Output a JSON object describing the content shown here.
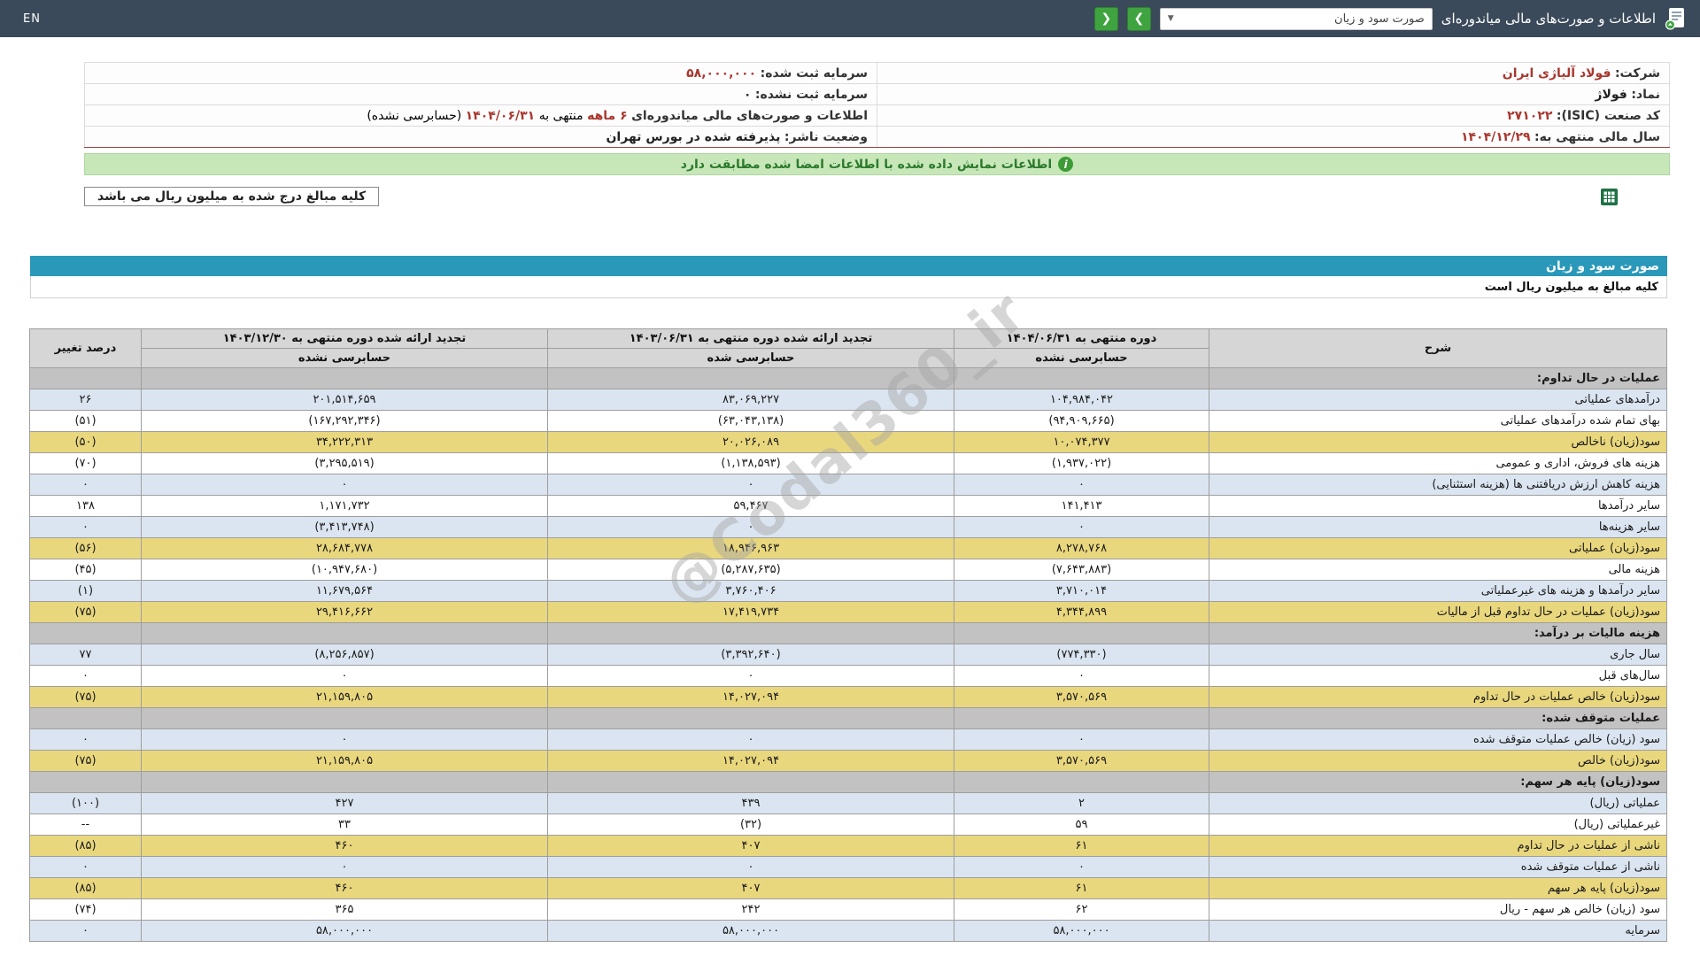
{
  "topbar": {
    "en_label": "EN",
    "title": "اطلاعات و صورت‌های مالی میاندوره‌ای",
    "dropdown_value": "صورت سود و زیان",
    "next_label": "❯",
    "prev_label": "❮"
  },
  "company_info": {
    "company_label": "شرکت:",
    "company_value": "فولاد آلیاژی ایران",
    "symbol_label": "نماد:",
    "symbol_value": "فولاژ",
    "isic_label": "کد صنعت (ISIC):",
    "isic_value": "۲۷۱۰۲۲",
    "fiscal_label": "سال مالی منتهی به:",
    "fiscal_value": "۱۴۰۴/۱۲/۲۹",
    "registered_capital_label": "سرمایه ثبت شده:",
    "registered_capital_value": "۵۸,۰۰۰,۰۰۰",
    "unregistered_capital_label": "سرمایه ثبت نشده:",
    "unregistered_capital_value": "۰",
    "period_label": "اطلاعات و صورت‌های مالی میاندوره‌ای",
    "period_months": "۶ ماهه",
    "period_middle": "منتهی به",
    "period_date": "۱۴۰۴/۰۶/۳۱",
    "period_suffix": "(حسابرسی نشده)",
    "status_label": "وضعیت ناشر:",
    "status_value": "پذیرفته شده در بورس تهران"
  },
  "banner": {
    "text": "اطلاعات نمایش داده شده با اطلاعات امضا شده مطابقت دارد"
  },
  "note_box": "کلیه مبالغ درج شده به میلیون ریال می باشد",
  "statement": {
    "title": "صورت سود و زیان",
    "subtitle": "کلیه مبالغ به میلیون ریال است",
    "watermark": "@Codal360_ir"
  },
  "table": {
    "headers": {
      "desc": "شرح",
      "col1_line1": "دوره منتهی به ۱۴۰۴/۰۶/۳۱",
      "col1_line2": "حسابرسی نشده",
      "col2_line1": "تجدید ارائه شده دوره منتهی به ۱۴۰۳/۰۶/۳۱",
      "col2_line2": "حسابرسی شده",
      "col3_line1": "تجدید ارائه شده دوره منتهی به ۱۴۰۳/۱۲/۳۰",
      "col3_line2": "حسابرسی نشده",
      "change": "درصد تغییر"
    },
    "rows": [
      {
        "style": "section",
        "desc": "عملیات در حال تداوم:",
        "v1": "",
        "v2": "",
        "v3": "",
        "chg": ""
      },
      {
        "style": "blue",
        "desc": "درآمدهای عملیاتی",
        "v1": "۱۰۴,۹۸۴,۰۴۲",
        "v2": "۸۳,۰۶۹,۲۲۷",
        "v3": "۲۰۱,۵۱۴,۶۵۹",
        "chg": "۲۶"
      },
      {
        "style": "white",
        "desc": "بهای تمام شده درآمدهای عملیاتی",
        "v1": "(۹۴,۹۰۹,۶۶۵)",
        "v2": "(۶۳,۰۴۳,۱۳۸)",
        "v3": "(۱۶۷,۲۹۲,۳۴۶)",
        "chg": "(۵۱)"
      },
      {
        "style": "yellow",
        "desc": "سود(زیان) ناخالص",
        "v1": "۱۰,۰۷۴,۳۷۷",
        "v2": "۲۰,۰۲۶,۰۸۹",
        "v3": "۳۴,۲۲۲,۳۱۳",
        "chg": "(۵۰)"
      },
      {
        "style": "white",
        "desc": "هزینه های فروش، اداری و عمومی",
        "v1": "(۱,۹۳۷,۰۲۲)",
        "v2": "(۱,۱۳۸,۵۹۳)",
        "v3": "(۳,۲۹۵,۵۱۹)",
        "chg": "(۷۰)"
      },
      {
        "style": "blue",
        "desc": "هزینه کاهش ارزش دریافتنی ها (هزینه استثنایی)",
        "v1": "۰",
        "v2": "۰",
        "v3": "۰",
        "chg": "۰"
      },
      {
        "style": "white",
        "desc": "سایر درآمدها",
        "v1": "۱۴۱,۴۱۳",
        "v2": "۵۹,۴۶۷",
        "v3": "۱,۱۷۱,۷۳۲",
        "chg": "۱۳۸"
      },
      {
        "style": "blue",
        "desc": "سایر هزینه‌ها",
        "v1": "۰",
        "v2": "۰",
        "v3": "(۳,۴۱۳,۷۴۸)",
        "chg": "۰"
      },
      {
        "style": "yellow",
        "desc": "سود(زیان) عملیاتی",
        "v1": "۸,۲۷۸,۷۶۸",
        "v2": "۱۸,۹۴۶,۹۶۳",
        "v3": "۲۸,۶۸۴,۷۷۸",
        "chg": "(۵۶)"
      },
      {
        "style": "white",
        "desc": "هزینه مالی",
        "v1": "(۷,۶۴۳,۸۸۳)",
        "v2": "(۵,۲۸۷,۶۳۵)",
        "v3": "(۱۰,۹۴۷,۶۸۰)",
        "chg": "(۴۵)"
      },
      {
        "style": "blue",
        "desc": "سایر درآمدها و هزینه های غیرعملیاتی",
        "v1": "۳,۷۱۰,۰۱۴",
        "v2": "۳,۷۶۰,۴۰۶",
        "v3": "۱۱,۶۷۹,۵۶۴",
        "chg": "(۱)"
      },
      {
        "style": "yellow",
        "desc": "سود(زیان) عملیات در حال تداوم قبل از مالیات",
        "v1": "۴,۳۴۴,۸۹۹",
        "v2": "۱۷,۴۱۹,۷۳۴",
        "v3": "۲۹,۴۱۶,۶۶۲",
        "chg": "(۷۵)"
      },
      {
        "style": "section",
        "desc": "هزینه مالیات بر درآمد:",
        "v1": "",
        "v2": "",
        "v3": "",
        "chg": ""
      },
      {
        "style": "blue",
        "desc": "سال جاری",
        "v1": "(۷۷۴,۳۳۰)",
        "v2": "(۳,۳۹۲,۶۴۰)",
        "v3": "(۸,۲۵۶,۸۵۷)",
        "chg": "۷۷"
      },
      {
        "style": "white",
        "desc": "سال‌های قبل",
        "v1": "۰",
        "v2": "۰",
        "v3": "۰",
        "chg": "۰"
      },
      {
        "style": "yellow",
        "desc": "سود(زیان) خالص عملیات در حال تداوم",
        "v1": "۳,۵۷۰,۵۶۹",
        "v2": "۱۴,۰۲۷,۰۹۴",
        "v3": "۲۱,۱۵۹,۸۰۵",
        "chg": "(۷۵)"
      },
      {
        "style": "section",
        "desc": "عملیات متوقف شده:",
        "v1": "",
        "v2": "",
        "v3": "",
        "chg": ""
      },
      {
        "style": "blue",
        "desc": "سود (زیان) خالص عملیات متوقف شده",
        "v1": "۰",
        "v2": "۰",
        "v3": "۰",
        "chg": "۰"
      },
      {
        "style": "yellow",
        "desc": "سود(زیان) خالص",
        "v1": "۳,۵۷۰,۵۶۹",
        "v2": "۱۴,۰۲۷,۰۹۴",
        "v3": "۲۱,۱۵۹,۸۰۵",
        "chg": "(۷۵)"
      },
      {
        "style": "section",
        "desc": "سود(زیان) پایه هر سهم:",
        "v1": "",
        "v2": "",
        "v3": "",
        "chg": ""
      },
      {
        "style": "blue",
        "desc": "عملیاتی (ریال)",
        "v1": "۲",
        "v2": "۴۳۹",
        "v3": "۴۲۷",
        "chg": "(۱۰۰)"
      },
      {
        "style": "white",
        "desc": "غیرعملیاتی (ریال)",
        "v1": "۵۹",
        "v2": "(۳۲)",
        "v3": "۳۳",
        "chg": "--"
      },
      {
        "style": "yellow",
        "desc": "ناشی از عملیات در حال تداوم",
        "v1": "۶۱",
        "v2": "۴۰۷",
        "v3": "۴۶۰",
        "chg": "(۸۵)"
      },
      {
        "style": "blue",
        "desc": "ناشی از عملیات متوقف شده",
        "v1": "۰",
        "v2": "۰",
        "v3": "۰",
        "chg": "۰"
      },
      {
        "style": "yellow",
        "desc": "سود(زیان) پایه هر سهم",
        "v1": "۶۱",
        "v2": "۴۰۷",
        "v3": "۴۶۰",
        "chg": "(۸۵)"
      },
      {
        "style": "white",
        "desc": "سود (زیان) خالص هر سهم - ریال",
        "v1": "۶۲",
        "v2": "۲۴۲",
        "v3": "۳۶۵",
        "chg": "(۷۴)"
      },
      {
        "style": "blue",
        "desc": "سرمایه",
        "v1": "۵۸,۰۰۰,۰۰۰",
        "v2": "۵۸,۰۰۰,۰۰۰",
        "v3": "۵۸,۰۰۰,۰۰۰",
        "chg": "۰"
      }
    ]
  }
}
